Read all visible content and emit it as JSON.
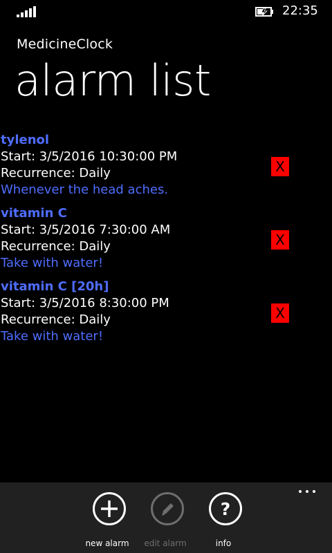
{
  "status_bar": {
    "time": "22:35"
  },
  "header": {
    "app_title": "MedicineClock",
    "page_title": "alarm list"
  },
  "alarms": [
    {
      "name": "tylenol",
      "start": "Start: 3/5/2016 10:30:00 PM",
      "recurrence": "Recurrence: Daily",
      "note": "Whenever the head aches.",
      "delete_label": "X"
    },
    {
      "name": "vitamin C",
      "start": "Start: 3/5/2016 7:30:00 AM",
      "recurrence": "Recurrence: Daily",
      "note": "Take with water!",
      "delete_label": "X"
    },
    {
      "name": "vitamin C [20h]",
      "start": "Start: 3/5/2016 8:30:00 PM",
      "recurrence": "Recurrence: Daily",
      "note": "Take with water!",
      "delete_label": "X"
    }
  ],
  "app_bar": {
    "buttons": [
      {
        "label": "new alarm",
        "icon": "plus-icon",
        "enabled": true
      },
      {
        "label": "edit alarm",
        "icon": "pencil-icon",
        "enabled": false
      },
      {
        "label": "info",
        "icon": "question-icon",
        "enabled": true
      }
    ]
  },
  "colors": {
    "accent": "#4f6dff",
    "delete": "#ff0000",
    "app_bar": "#212121",
    "disabled": "#6e6e6e"
  }
}
